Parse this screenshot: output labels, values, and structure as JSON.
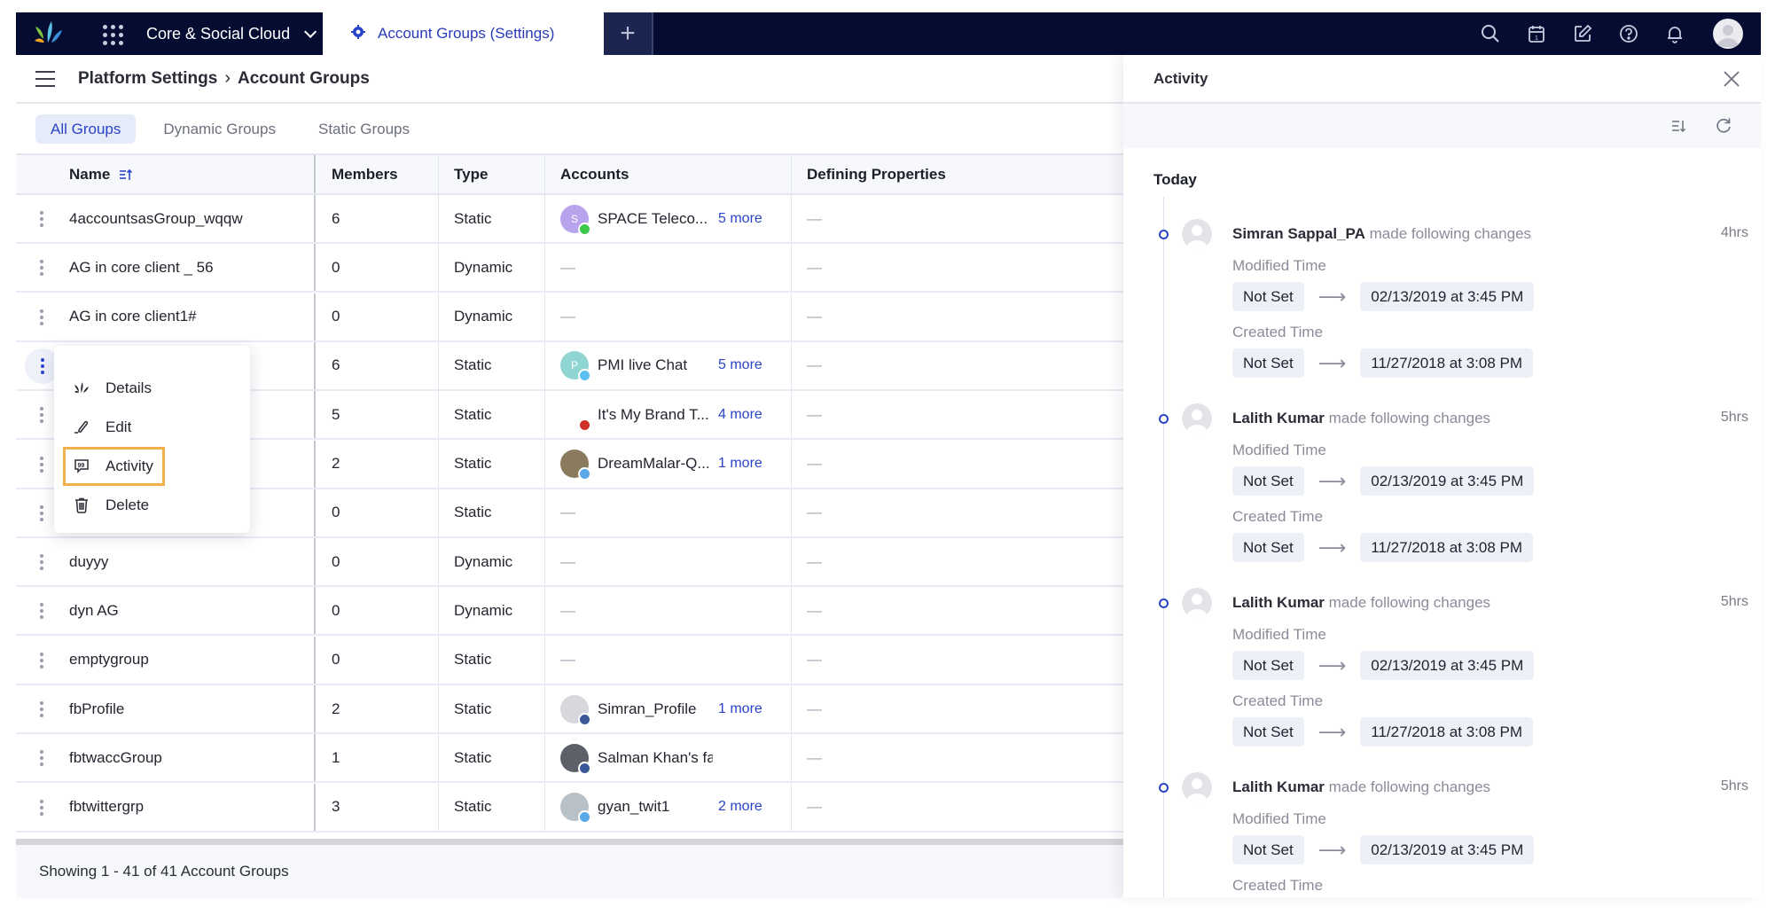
{
  "navbar": {
    "product": "Core & Social Cloud",
    "active_tab": "Account Groups (Settings)",
    "new_tab": "+",
    "icons": [
      "search-icon",
      "calendar-icon",
      "compose-icon",
      "help-icon",
      "bell-icon",
      "user-avatar"
    ]
  },
  "header": {
    "breadcrumb_parent": "Platform Settings",
    "breadcrumb_separator": "›",
    "breadcrumb_current": "Account Groups"
  },
  "filter_tabs": [
    {
      "label": "All Groups",
      "active": true
    },
    {
      "label": "Dynamic Groups",
      "active": false
    },
    {
      "label": "Static Groups",
      "active": false
    }
  ],
  "table": {
    "columns": {
      "name": "Name",
      "members": "Members",
      "type": "Type",
      "accounts": "Accounts",
      "defining": "Defining Properties"
    },
    "empty": "—",
    "rows": [
      {
        "name": "4accountsasGroup_wqqw",
        "members": "6",
        "type": "Static",
        "account": "SPACE Teleco...",
        "more": "5 more",
        "avatar_letter": "S",
        "avatar_color": "#b7a4ec",
        "badge": "chat",
        "badge_color": "#3fc94a"
      },
      {
        "name": "AG in core client _ 56",
        "members": "0",
        "type": "Dynamic"
      },
      {
        "name": "AG in core client1#",
        "members": "0",
        "type": "Dynamic"
      },
      {
        "name": "",
        "members": "6",
        "type": "Static",
        "account": "PMI live Chat",
        "more": "5 more",
        "avatar_letter": "P",
        "avatar_color": "#8fd6d2",
        "badge": "chat",
        "badge_color": "#5bc0ef"
      },
      {
        "name": "",
        "members": "5",
        "type": "Static",
        "account": "It's My Brand T...",
        "more": "4 more",
        "avatar_letter": "",
        "avatar_color": "#ffffff",
        "badge": "youtube",
        "badge_color": "#d0302a"
      },
      {
        "name": "",
        "members": "2",
        "type": "Static",
        "account": "DreamMalar-Q...",
        "more": "1 more",
        "avatar_letter": "",
        "avatar_color": "#8a7a5e",
        "badge": "twitter",
        "badge_color": "#5aa8ea"
      },
      {
        "name": "",
        "members": "0",
        "type": "Static"
      },
      {
        "name": "duyyy",
        "members": "0",
        "type": "Dynamic"
      },
      {
        "name": "dyn AG",
        "members": "0",
        "type": "Dynamic"
      },
      {
        "name": "emptygroup",
        "members": "0",
        "type": "Static"
      },
      {
        "name": "fbProfile",
        "members": "2",
        "type": "Static",
        "account": "Simran_Profile",
        "more": "1 more",
        "avatar_letter": "",
        "avatar_color": "#d7d8dc",
        "badge": "facebook",
        "badge_color": "#3b5998"
      },
      {
        "name": "fbtwaccGroup",
        "members": "1",
        "type": "Static",
        "account": "Salman Khan's fans",
        "more": "",
        "avatar_letter": "",
        "avatar_color": "#5c6068",
        "badge": "facebook",
        "badge_color": "#3b5998"
      },
      {
        "name": "fbtwittergrp",
        "members": "3",
        "type": "Static",
        "account": "gyan_twit1",
        "more": "2 more",
        "avatar_letter": "",
        "avatar_color": "#b8c0c8",
        "badge": "twitter",
        "badge_color": "#5aa8ea"
      }
    ],
    "footer": "Showing 1 - 41 of 41 Account Groups"
  },
  "context_menu": {
    "items": [
      {
        "label": "Details",
        "icon": "logo-icon"
      },
      {
        "label": "Edit",
        "icon": "pencil-icon"
      },
      {
        "label": "Activity",
        "icon": "activity-icon",
        "focused": true
      },
      {
        "label": "Delete",
        "icon": "trash-icon"
      }
    ]
  },
  "activity": {
    "title": "Activity",
    "section": "Today",
    "entries": [
      {
        "user": "Simran Sappal_PA",
        "action": "made following changes",
        "time": "4hrs",
        "changes": [
          {
            "field": "Modified Time",
            "from": "Not Set",
            "to": "02/13/2019 at 3:45 PM"
          },
          {
            "field": "Created Time",
            "from": "Not Set",
            "to": "11/27/2018 at 3:08 PM"
          }
        ]
      },
      {
        "user": "Lalith Kumar",
        "action": "made following changes",
        "time": "5hrs",
        "changes": [
          {
            "field": "Modified Time",
            "from": "Not Set",
            "to": "02/13/2019 at 3:45 PM"
          },
          {
            "field": "Created Time",
            "from": "Not Set",
            "to": "11/27/2018 at 3:08 PM"
          }
        ]
      },
      {
        "user": "Lalith Kumar",
        "action": "made following changes",
        "time": "5hrs",
        "changes": [
          {
            "field": "Modified Time",
            "from": "Not Set",
            "to": "02/13/2019 at 3:45 PM"
          },
          {
            "field": "Created Time",
            "from": "Not Set",
            "to": "11/27/2018 at 3:08 PM"
          }
        ]
      },
      {
        "user": "Lalith Kumar",
        "action": "made following changes",
        "time": "5hrs",
        "changes": [
          {
            "field": "Modified Time",
            "from": "Not Set",
            "to": "02/13/2019 at 3:45 PM"
          },
          {
            "field": "Created Time",
            "from": "",
            "to": ""
          }
        ]
      }
    ]
  },
  "colors": {
    "navbar": "#050c32",
    "accent": "#2a44c8",
    "focus_outline": "#f2b04c"
  }
}
